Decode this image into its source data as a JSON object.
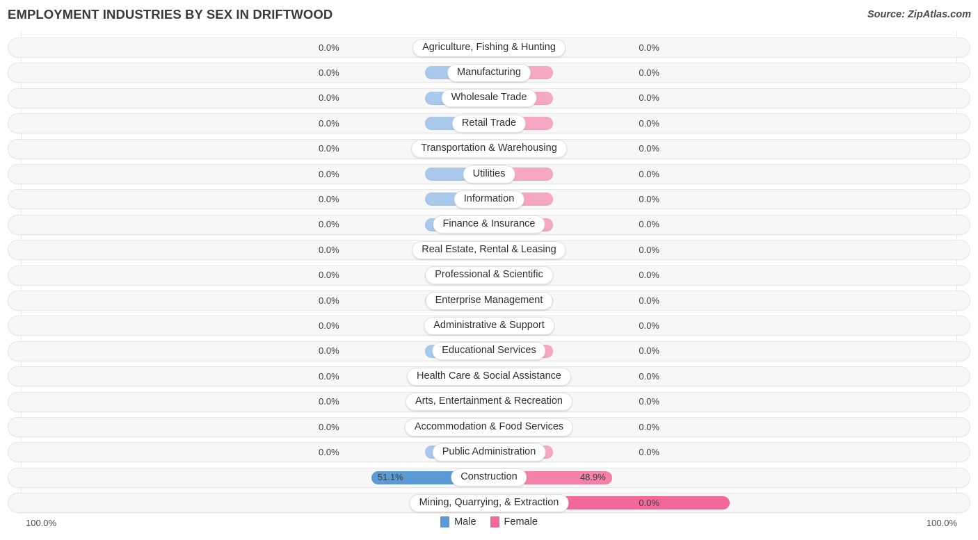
{
  "header": {
    "title": "EMPLOYMENT INDUSTRIES BY SEX IN DRIFTWOOD",
    "source": "Source: ZipAtlas.com"
  },
  "legend": {
    "male_label": "Male",
    "female_label": "Female",
    "male_color": "#5b9bd5",
    "female_color": "#f2689a"
  },
  "axis": {
    "left_end": "100.0%",
    "right_end": "100.0%"
  },
  "colors": {
    "male_zero": "#a9c9ec",
    "male_active": "#5b9bd5",
    "female_zero": "#f6a7c4",
    "female_active_light": "#f581ab",
    "female_active": "#f2689a",
    "row_track": "#f7f7f7",
    "row_border": "#e6e6e6"
  },
  "chart_data": {
    "type": "bar",
    "title": "EMPLOYMENT INDUSTRIES BY SEX IN DRIFTWOOD",
    "subtitle": "Source: ZipAtlas.com",
    "orientation": "horizontal-diverging",
    "xlabel": "",
    "ylabel": "",
    "xlim": [
      100,
      100
    ],
    "grid": false,
    "legend_position": "bottom-center",
    "categories": [
      "Agriculture, Fishing & Hunting",
      "Manufacturing",
      "Wholesale Trade",
      "Retail Trade",
      "Transportation & Warehousing",
      "Utilities",
      "Information",
      "Finance & Insurance",
      "Real Estate, Rental & Leasing",
      "Professional & Scientific",
      "Enterprise Management",
      "Administrative & Support",
      "Educational Services",
      "Health Care & Social Assistance",
      "Arts, Entertainment & Recreation",
      "Accommodation & Food Services",
      "Public Administration",
      "Construction",
      "Mining, Quarrying, & Extraction"
    ],
    "series": [
      {
        "name": "Male",
        "color": "#5b9bd5",
        "values": [
          0.0,
          0.0,
          0.0,
          0.0,
          0.0,
          0.0,
          0.0,
          0.0,
          0.0,
          0.0,
          0.0,
          0.0,
          0.0,
          0.0,
          0.0,
          0.0,
          0.0,
          48.9,
          0.0
        ]
      },
      {
        "name": "Female",
        "color": "#f2689a",
        "values": [
          0.0,
          0.0,
          0.0,
          0.0,
          0.0,
          0.0,
          0.0,
          0.0,
          0.0,
          0.0,
          0.0,
          0.0,
          0.0,
          0.0,
          0.0,
          0.0,
          0.0,
          51.1,
          100.0
        ]
      }
    ]
  },
  "rows": [
    {
      "label": "Agriculture, Fishing & Hunting",
      "male": "0.0%",
      "female": "0.0%",
      "male_pct": 0.0,
      "female_pct": 0.0
    },
    {
      "label": "Manufacturing",
      "male": "0.0%",
      "female": "0.0%",
      "male_pct": 0.0,
      "female_pct": 0.0
    },
    {
      "label": "Wholesale Trade",
      "male": "0.0%",
      "female": "0.0%",
      "male_pct": 0.0,
      "female_pct": 0.0
    },
    {
      "label": "Retail Trade",
      "male": "0.0%",
      "female": "0.0%",
      "male_pct": 0.0,
      "female_pct": 0.0
    },
    {
      "label": "Transportation & Warehousing",
      "male": "0.0%",
      "female": "0.0%",
      "male_pct": 0.0,
      "female_pct": 0.0
    },
    {
      "label": "Utilities",
      "male": "0.0%",
      "female": "0.0%",
      "male_pct": 0.0,
      "female_pct": 0.0
    },
    {
      "label": "Information",
      "male": "0.0%",
      "female": "0.0%",
      "male_pct": 0.0,
      "female_pct": 0.0
    },
    {
      "label": "Finance & Insurance",
      "male": "0.0%",
      "female": "0.0%",
      "male_pct": 0.0,
      "female_pct": 0.0
    },
    {
      "label": "Real Estate, Rental & Leasing",
      "male": "0.0%",
      "female": "0.0%",
      "male_pct": 0.0,
      "female_pct": 0.0
    },
    {
      "label": "Professional & Scientific",
      "male": "0.0%",
      "female": "0.0%",
      "male_pct": 0.0,
      "female_pct": 0.0
    },
    {
      "label": "Enterprise Management",
      "male": "0.0%",
      "female": "0.0%",
      "male_pct": 0.0,
      "female_pct": 0.0
    },
    {
      "label": "Administrative & Support",
      "male": "0.0%",
      "female": "0.0%",
      "male_pct": 0.0,
      "female_pct": 0.0
    },
    {
      "label": "Educational Services",
      "male": "0.0%",
      "female": "0.0%",
      "male_pct": 0.0,
      "female_pct": 0.0
    },
    {
      "label": "Health Care & Social Assistance",
      "male": "0.0%",
      "female": "0.0%",
      "male_pct": 0.0,
      "female_pct": 0.0
    },
    {
      "label": "Arts, Entertainment & Recreation",
      "male": "0.0%",
      "female": "0.0%",
      "male_pct": 0.0,
      "female_pct": 0.0
    },
    {
      "label": "Accommodation & Food Services",
      "male": "0.0%",
      "female": "0.0%",
      "male_pct": 0.0,
      "female_pct": 0.0
    },
    {
      "label": "Public Administration",
      "male": "0.0%",
      "female": "0.0%",
      "male_pct": 0.0,
      "female_pct": 0.0
    },
    {
      "label": "Construction",
      "male": "48.9%",
      "female": "51.1%",
      "male_pct": 48.9,
      "female_pct": 51.1
    },
    {
      "label": "Mining, Quarrying, & Extraction",
      "male": "0.0%",
      "female": "100.0%",
      "male_pct": 0.0,
      "female_pct": 100.0
    }
  ]
}
